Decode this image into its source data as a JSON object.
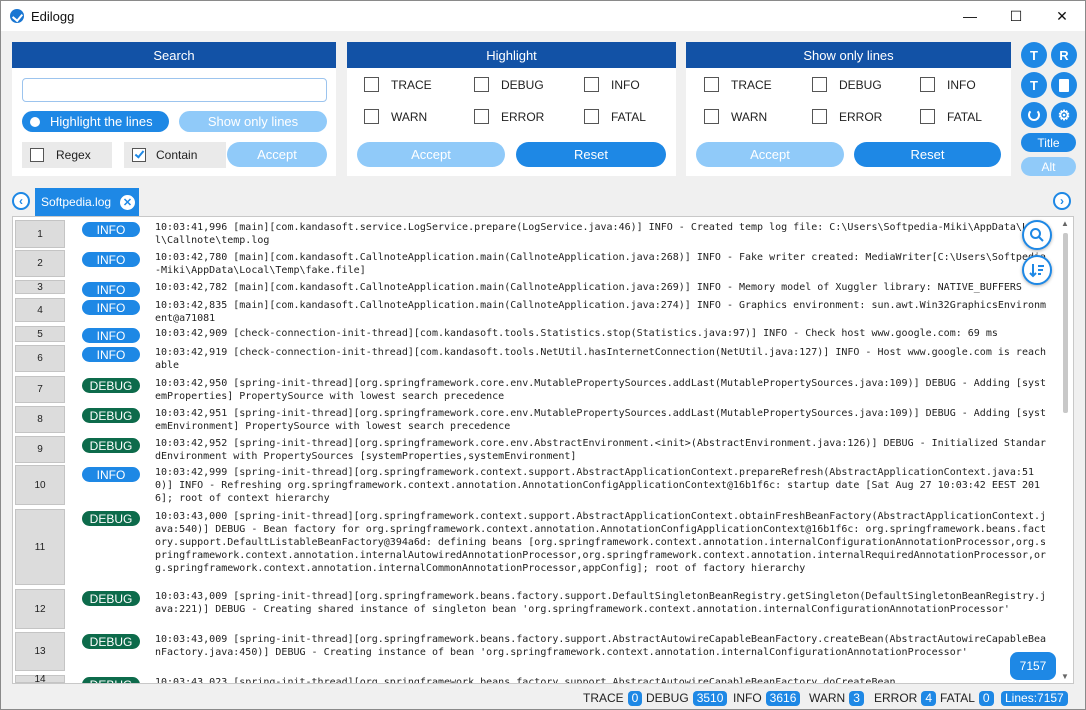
{
  "window": {
    "title": "Edilogg",
    "min": "—",
    "max": "☐",
    "close": "✕"
  },
  "search": {
    "header": "Search",
    "input_value": "",
    "placeholder": "",
    "highlight_lines": "Highlight the lines",
    "show_only_lines": "Show only lines",
    "regex": "Regex",
    "contain": "Contain",
    "accept": "Accept"
  },
  "highlight": {
    "header": "Highlight",
    "levels": [
      "TRACE",
      "DEBUG",
      "INFO",
      "WARN",
      "ERROR",
      "FATAL"
    ],
    "accept": "Accept",
    "reset": "Reset"
  },
  "show_only": {
    "header": "Show only lines",
    "levels": [
      "TRACE",
      "DEBUG",
      "INFO",
      "WARN",
      "ERROR",
      "FATAL"
    ],
    "accept": "Accept",
    "reset": "Reset"
  },
  "side": {
    "t_plus": "T",
    "r": "R",
    "title": "Title",
    "alt": "Alt"
  },
  "tab": {
    "label": "Softpedia.log",
    "close": "✕"
  },
  "colors": {
    "accent": "#1e88e5",
    "header": "#1252a6",
    "info": "#1e88e5",
    "debug": "#0d6b4b"
  },
  "rows": [
    {
      "n": "1",
      "level": "INFO",
      "text": "10:03:41,996 [main][com.kandasoft.service.LogService.prepare(LogService.java:46)] INFO - Created temp log file: C:\\Users\\Softpedia-Miki\\AppData\\Local\\Callnote\\temp.log"
    },
    {
      "n": "2",
      "level": "INFO",
      "text": "10:03:42,780 [main][com.kandasoft.CallnoteApplication.main(CallnoteApplication.java:268)] INFO - Fake writer created: MediaWriter[C:\\Users\\Softpedia-Miki\\AppData\\Local\\Temp\\fake.file]"
    },
    {
      "n": "3",
      "level": "INFO",
      "text": "10:03:42,782 [main][com.kandasoft.CallnoteApplication.main(CallnoteApplication.java:269)] INFO - Memory model of Xuggler library: NATIVE_BUFFERS"
    },
    {
      "n": "4",
      "level": "INFO",
      "text": "10:03:42,835 [main][com.kandasoft.CallnoteApplication.main(CallnoteApplication.java:274)] INFO - Graphics environment: sun.awt.Win32GraphicsEnvironment@a71081"
    },
    {
      "n": "5",
      "level": "INFO",
      "text": "10:03:42,909 [check-connection-init-thread][com.kandasoft.tools.Statistics.stop(Statistics.java:97)] INFO - Check host www.google.com: 69 ms"
    },
    {
      "n": "6",
      "level": "INFO",
      "text": "10:03:42,919 [check-connection-init-thread][com.kandasoft.tools.NetUtil.hasInternetConnection(NetUtil.java:127)] INFO - Host www.google.com is reachable"
    },
    {
      "n": "7",
      "level": "DEBUG",
      "text": "10:03:42,950 [spring-init-thread][org.springframework.core.env.MutablePropertySources.addLast(MutablePropertySources.java:109)] DEBUG - Adding [systemProperties] PropertySource with lowest search precedence"
    },
    {
      "n": "8",
      "level": "DEBUG",
      "text": "10:03:42,951 [spring-init-thread][org.springframework.core.env.MutablePropertySources.addLast(MutablePropertySources.java:109)] DEBUG - Adding [systemEnvironment] PropertySource with lowest search precedence"
    },
    {
      "n": "9",
      "level": "DEBUG",
      "text": "10:03:42,952 [spring-init-thread][org.springframework.core.env.AbstractEnvironment.<init>(AbstractEnvironment.java:126)] DEBUG - Initialized StandardEnvironment with PropertySources [systemProperties,systemEnvironment]"
    },
    {
      "n": "10",
      "level": "INFO",
      "text": "10:03:42,999 [spring-init-thread][org.springframework.context.support.AbstractApplicationContext.prepareRefresh(AbstractApplicationContext.java:510)] INFO - Refreshing org.springframework.context.annotation.AnnotationConfigApplicationContext@16b1f6c: startup date [Sat Aug 27 10:03:42 EEST 2016]; root of context hierarchy"
    },
    {
      "n": "11",
      "level": "DEBUG",
      "text": "10:03:43,000 [spring-init-thread][org.springframework.context.support.AbstractApplicationContext.obtainFreshBeanFactory(AbstractApplicationContext.java:540)] DEBUG - Bean factory for org.springframework.context.annotation.AnnotationConfigApplicationContext@16b1f6c: org.springframework.beans.factory.support.DefaultListableBeanFactory@394a6d: defining beans [org.springframework.context.annotation.internalConfigurationAnnotationProcessor,org.springframework.context.annotation.internalAutowiredAnnotationProcessor,org.springframework.context.annotation.internalRequiredAnnotationProcessor,org.springframework.context.annotation.internalCommonAnnotationProcessor,appConfig]; root of factory hierarchy"
    },
    {
      "n": "12",
      "level": "DEBUG",
      "text": "10:03:43,009 [spring-init-thread][org.springframework.beans.factory.support.DefaultSingletonBeanRegistry.getSingleton(DefaultSingletonBeanRegistry.java:221)] DEBUG - Creating shared instance of singleton bean 'org.springframework.context.annotation.internalConfigurationAnnotationProcessor'"
    },
    {
      "n": "13",
      "level": "DEBUG",
      "text": "10:03:43,009 [spring-init-thread][org.springframework.beans.factory.support.AbstractAutowireCapableBeanFactory.createBean(AbstractAutowireCapableBeanFactory.java:450)] DEBUG - Creating instance of bean 'org.springframework.context.annotation.internalConfigurationAnnotationProcessor'"
    },
    {
      "n": "14",
      "level": "DEBUG",
      "text": "10:03:43,023 [spring-init-thread][org.springframework.beans.factory.support.AbstractAutowireCapableBeanFactory.doCreateBean"
    }
  ],
  "count_badge": "7157",
  "status": {
    "items": [
      {
        "label": "TRACE",
        "count": "0"
      },
      {
        "label": "DEBUG",
        "count": "3510"
      },
      {
        "label": "INFO",
        "count": "3616"
      },
      {
        "label": "WARN",
        "count": "3"
      },
      {
        "label": "ERROR",
        "count": "4"
      },
      {
        "label": "FATAL",
        "count": "0"
      }
    ],
    "lines": "Lines:7157"
  }
}
